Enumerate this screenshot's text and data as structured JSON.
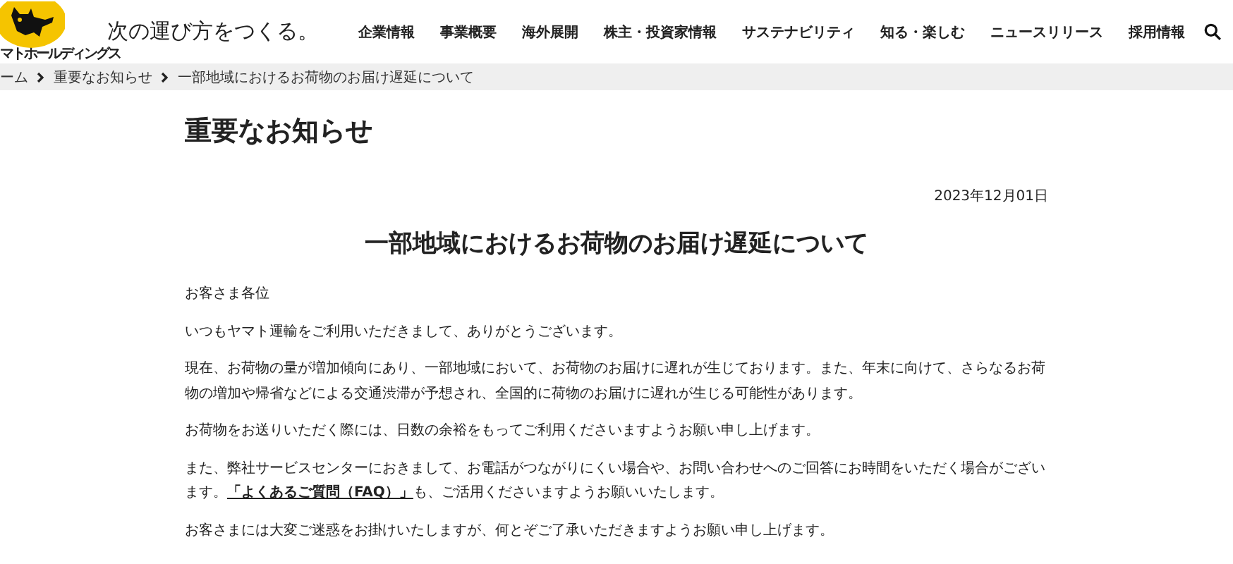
{
  "header": {
    "logo_text": "マトホールディングス",
    "tagline": "次の運び方をつくる。",
    "nav": [
      "企業情報",
      "事業概要",
      "海外展開",
      "株主・投資家情報",
      "サステナビリティ",
      "知る・楽しむ",
      "ニュースリリース",
      "採用情報"
    ]
  },
  "breadcrumb": [
    "ーム",
    "重要なお知らせ",
    "一部地域におけるお荷物のお届け遅延について"
  ],
  "page_title": "重要なお知らせ",
  "date": "2023年12月01日",
  "headline": "一部地域におけるお荷物のお届け遅延について",
  "paragraphs": [
    {
      "text": "お客さま各位"
    },
    {
      "text": "いつもヤマト運輸をご利用いただきまして、ありがとうございます。"
    },
    {
      "text": "現在、お荷物の量が増加傾向にあり、一部地域において、お荷物のお届けに遅れが生じております。また、年末に向けて、さらなるお荷物の増加や帰省などによる交通渋滞が予想され、全国的に荷物のお届けに遅れが生じる可能性があります。"
    },
    {
      "text": "お荷物をお送りいただく際には、日数の余裕をもってご利用くださいますようお願い申し上げます。"
    },
    {
      "text": "また、弊社サービスセンターにおきまして、お電話がつながりにくい場合や、お問い合わせへのご回答にお時間をいただく場合がございます。",
      "link": "「よくあるご質問（FAQ）」",
      "after": "も、ご活用くださいますようお願いいたします。"
    },
    {
      "text": "お客さまには大変ご迷惑をお掛けいたしますが、何とぞご了承いただきますようお願い申し上げます。"
    }
  ]
}
